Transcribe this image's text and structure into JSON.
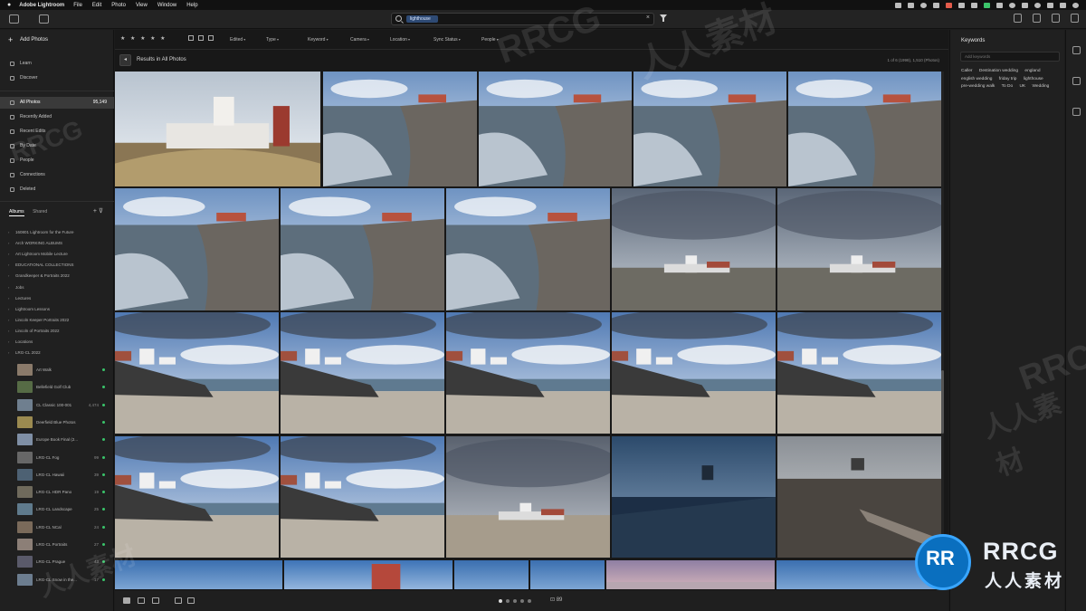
{
  "menubar": {
    "app_name": "Adobe Lightroom",
    "menus": [
      "File",
      "Edit",
      "Photo",
      "View",
      "Window",
      "Help"
    ]
  },
  "toolbar": {
    "search_chip": "lighthouse",
    "clear_symbol": "×"
  },
  "left_panel": {
    "add_photos": "Add Photos",
    "learn": "Learn",
    "discover": "Discover",
    "all_photos": {
      "label": "All Photos",
      "count": "95,149"
    },
    "library_items": [
      {
        "label": "Recently Added",
        "icon": "clock-icon"
      },
      {
        "label": "Recent Edits",
        "icon": "edit-icon"
      },
      {
        "label": "By Date",
        "icon": "calendar-icon"
      },
      {
        "label": "People",
        "icon": "person-icon"
      },
      {
        "label": "Connections",
        "icon": "link-icon"
      },
      {
        "label": "Deleted",
        "icon": "trash-icon"
      }
    ],
    "tabs": [
      "Albums",
      "Shared"
    ],
    "tab_tools": "+ ⊽",
    "albums": [
      "160801 Lightroom for the Future",
      "Arch WORKING ALBUMS",
      "Art Lightroom Mobile Lecture",
      "EDUCATIONAL COLLECTIONS",
      "Grandkeeper & Portraits 2022",
      "Jobs",
      "Lectures",
      "Lightroom Lessons",
      "Lincoln Keeper Portraits 2022",
      "Lincoln of Portraits 2022",
      "Locations",
      "LRG-CL 2022"
    ],
    "album_photos": [
      {
        "label": "Art Walk",
        "count": ""
      },
      {
        "label": "Bellefield Golf Club",
        "count": ""
      },
      {
        "label": "CL Classic 100-001",
        "count": "4,474"
      },
      {
        "label": "Deerfield Blue Photos",
        "count": ""
      },
      {
        "label": "Europe Book Final (2...",
        "count": ""
      },
      {
        "label": "LRG-CL Fog",
        "count": "99"
      },
      {
        "label": "LRG-CL Hawaii",
        "count": "39"
      },
      {
        "label": "LRG-CL HDR Pano",
        "count": "19"
      },
      {
        "label": "LRG-CL Landscape",
        "count": "25"
      },
      {
        "label": "LRG-CL NCal",
        "count": "24"
      },
      {
        "label": "LRG-CL Portraits",
        "count": "27"
      },
      {
        "label": "LRG-CL Prague",
        "count": "43"
      },
      {
        "label": "LRG-CL Snow in the...",
        "count": "17"
      }
    ]
  },
  "filterbar": {
    "stars": "★ ★ ★ ★ ★",
    "dropdowns": [
      "Edited",
      "Type",
      "Keyword",
      "Camera",
      "Location",
      "Sync Status",
      "People"
    ]
  },
  "results": {
    "back_symbol": "◂",
    "title": "Results in All Photos",
    "count": "1 of 6 (1998), 1,510 (Photos)"
  },
  "bottom": {
    "comment": "⊡ 89"
  },
  "right_panel": {
    "title": "Keywords",
    "input_placeholder": "Add keywords",
    "keywords": [
      "Caller",
      "Destination wedding",
      "england",
      "english wedding",
      "friday trip",
      "lighthouse",
      "pre-wedding walk",
      "To Do",
      "UK",
      "Wedding"
    ]
  },
  "watermarks": [
    "RRCG",
    "人人素材",
    "RRCG",
    "人人素材",
    "RRCG",
    "人人素材"
  ],
  "logo": {
    "brand": "RRCG",
    "subtitle": "人人素材"
  }
}
